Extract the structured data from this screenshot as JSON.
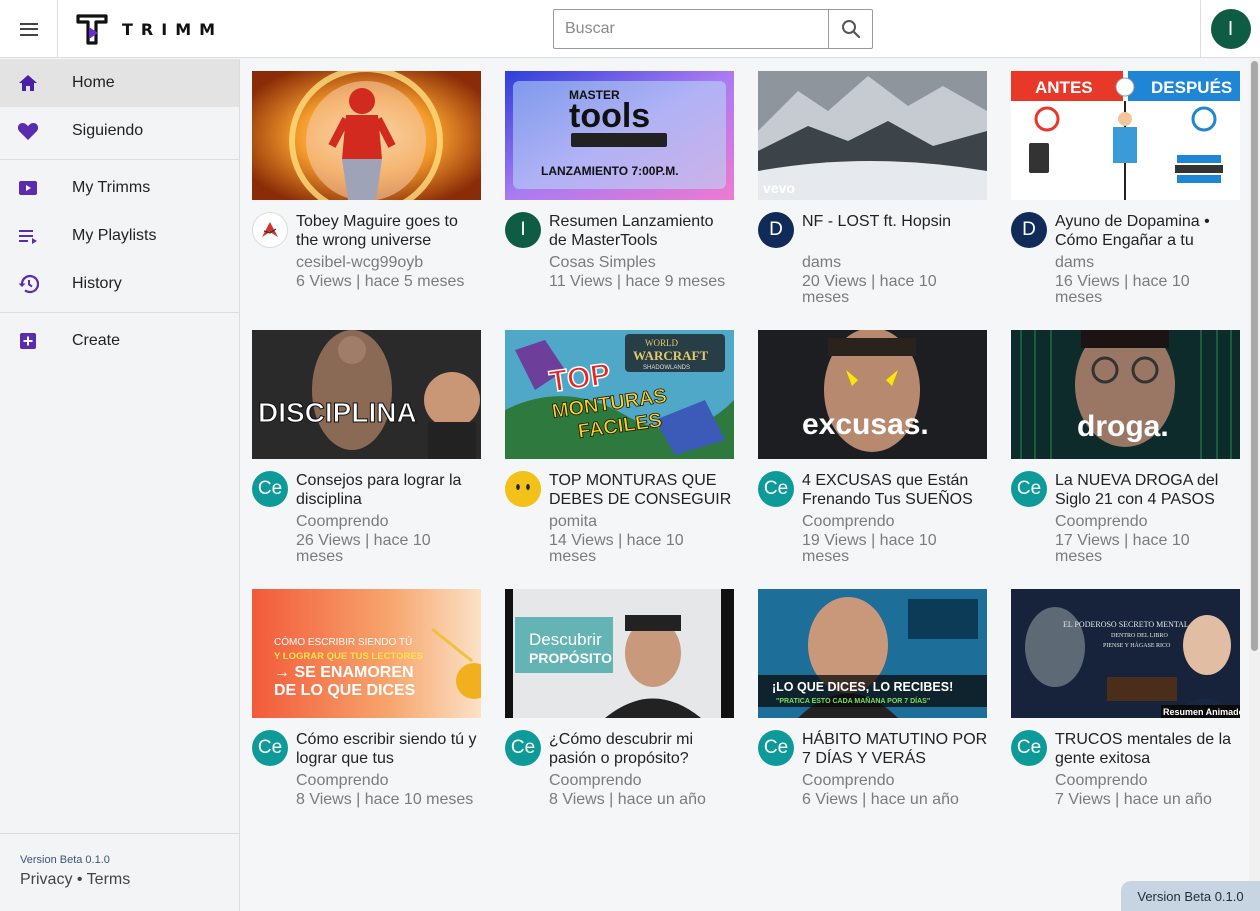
{
  "app": {
    "name": "TRIMM"
  },
  "search": {
    "placeholder": "Buscar"
  },
  "user": {
    "initial": "I",
    "avatar_color": "#0d5c43"
  },
  "sidebar": {
    "items": [
      {
        "label": "Home",
        "icon": "home-icon",
        "active": true
      },
      {
        "label": "Siguiendo",
        "icon": "heart-icon"
      },
      {
        "label": "My Trimms",
        "icon": "video-camera-icon"
      },
      {
        "label": "My Playlists",
        "icon": "playlist-icon"
      },
      {
        "label": "History",
        "icon": "history-icon"
      },
      {
        "label": "Create",
        "icon": "add-box-icon"
      }
    ],
    "footer": {
      "version": "Version Beta 0.1.0",
      "privacy": "Privacy",
      "separator": "•",
      "terms": "Terms"
    }
  },
  "accent_color": "#5b2bb0",
  "version_badge": "Version Beta 0.1.0",
  "videos": [
    {
      "title": "Tobey Maguire goes to the wrong universe",
      "channel": "cesibel-wcg99oyb",
      "stats": "6 Views | hace 5 meses",
      "avatar": "",
      "avatar_color": "#ffffff"
    },
    {
      "title": "Resumen Lanzamiento de MasterTools",
      "channel": "Cosas Simples",
      "stats": "11 Views | hace 9 meses",
      "avatar": "I",
      "avatar_color": "#0d5c43"
    },
    {
      "title": "NF - LOST ft. Hopsin",
      "channel": "dams",
      "stats": "20 Views | hace 10 meses",
      "avatar": "D",
      "avatar_color": "#102a5a"
    },
    {
      "title": "Ayuno de Dopamina • Cómo Engañar a tu",
      "channel": "dams",
      "stats": "16 Views | hace 10 meses",
      "avatar": "D",
      "avatar_color": "#102a5a"
    },
    {
      "title": "Consejos para lograr la disciplina",
      "channel": "Coomprendo",
      "stats": "26 Views | hace 10 meses",
      "avatar": "Ce",
      "avatar_color": "#0f9a9a"
    },
    {
      "title": "TOP MONTURAS QUE DEBES DE CONSEGUIR",
      "channel": "pomita",
      "stats": "14 Views | hace 10 meses",
      "avatar": "",
      "avatar_color": "#f2c21b"
    },
    {
      "title": "4 EXCUSAS que Están Frenando Tus SUEÑOS",
      "channel": "Coomprendo",
      "stats": "19 Views | hace 10 meses",
      "avatar": "Ce",
      "avatar_color": "#0f9a9a"
    },
    {
      "title": "La NUEVA DROGA del Siglo 21 con 4 PASOS",
      "channel": "Coomprendo",
      "stats": "17 Views | hace 10 meses",
      "avatar": "Ce",
      "avatar_color": "#0f9a9a"
    },
    {
      "title": "Cómo escribir siendo tú y lograr que tus",
      "channel": "Coomprendo",
      "stats": "8 Views | hace 10 meses",
      "avatar": "Ce",
      "avatar_color": "#0f9a9a"
    },
    {
      "title": "¿Cómo descubrir mi pasión o propósito?",
      "channel": "Coomprendo",
      "stats": "8 Views | hace un año",
      "avatar": "Ce",
      "avatar_color": "#0f9a9a"
    },
    {
      "title": "HÁBITO MATUTINO POR 7 DÍAS Y VERÁS",
      "channel": "Coomprendo",
      "stats": "6 Views | hace un año",
      "avatar": "Ce",
      "avatar_color": "#0f9a9a"
    },
    {
      "title": "TRUCOS mentales de la gente exitosa",
      "channel": "Coomprendo",
      "stats": "7 Views | hace un año",
      "avatar": "Ce",
      "avatar_color": "#0f9a9a"
    }
  ],
  "thumbnail_text": {
    "t1": {
      "line1": "MASTER",
      "line2": "tools",
      "line3": "LANZAMIENTO 7:00P.M."
    },
    "t2": {
      "logo": "vevo"
    },
    "t3": {
      "left": "ANTES",
      "right": "DESPUÉS"
    },
    "t4": {
      "word": "DISCIPLINA"
    },
    "t5": {
      "line1": "TOP",
      "line2": "MONTURAS",
      "line3": "FACILES",
      "badge1": "WORLD",
      "badge2": "WARCRAFT",
      "badge3": "SHADOWLANDS"
    },
    "t6": {
      "word": "excusas."
    },
    "t7": {
      "word": "droga."
    },
    "t8": {
      "line1": "CÓMO ESCRIBIR SIENDO TÚ",
      "line2": "Y LOGRAR QUE TUS LECTORES",
      "line3": "→ SE ENAMOREN",
      "line4": "DE LO QUE DICES"
    },
    "t9": {
      "line1": "Descubrir",
      "line2": "PROPÓSITO"
    },
    "t10": {
      "line1": "¡LO QUE DICES, LO RECIBES!",
      "line2": "\"PRATICA ESTO CADA MAÑANA POR 7 DÍAS\""
    },
    "t11": {
      "line1": "EL PODEROSO SECRETO MENTAL",
      "line2": "DENTRO DEL LIBRO",
      "line3": "PIENSE Y HÁGASE RICO",
      "line4": "Resumen Animado"
    }
  }
}
